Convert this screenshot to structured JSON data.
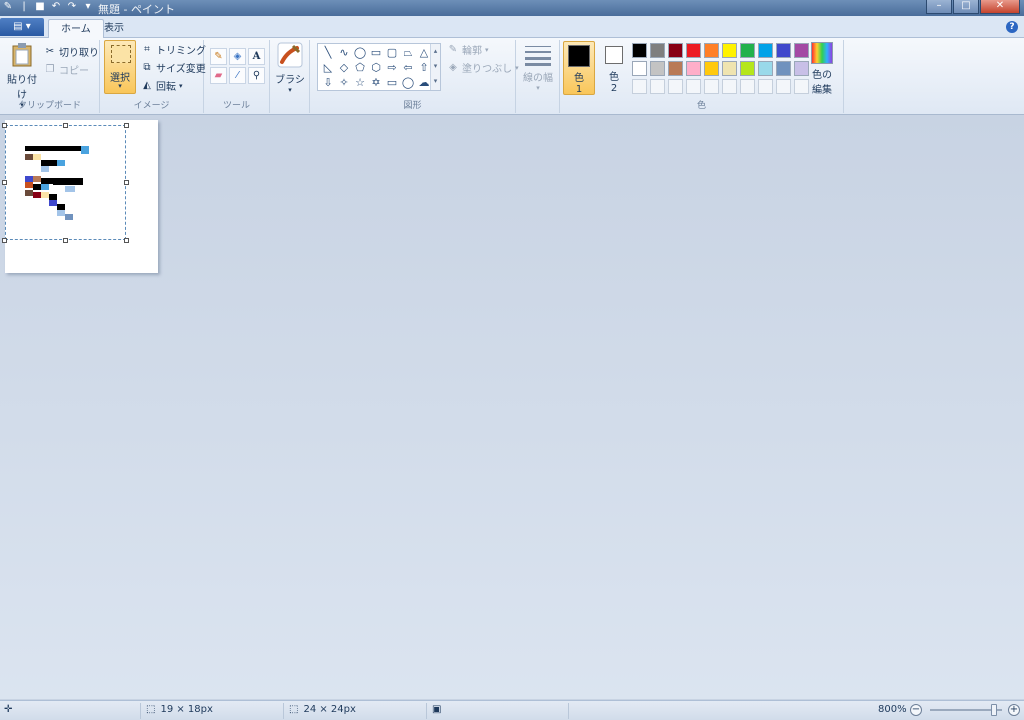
{
  "window": {
    "title": "無題 - ペイント",
    "buttons": {
      "minimize": "–",
      "maximize": "□",
      "close": "✕"
    }
  },
  "tabs": {
    "app_menu": "▤ ▾",
    "home": "ホーム",
    "view": "表示",
    "help": "?"
  },
  "clipboard": {
    "paste": "貼り付け",
    "cut": "切り取り",
    "copy": "コピー",
    "label": "クリップボード"
  },
  "image": {
    "select": "選択",
    "crop": "トリミング",
    "resize": "サイズ変更",
    "rotate": "回転",
    "label": "イメージ"
  },
  "tools": {
    "label": "ツール"
  },
  "brushes": {
    "label": "ブラシ"
  },
  "shapes": {
    "outline": "輪郭",
    "fill": "塗りつぶし",
    "label": "図形"
  },
  "size": {
    "label": "線の幅"
  },
  "colors": {
    "color1_label": "色\n1",
    "color1_a": "色",
    "color1_b": "1",
    "color2_a": "色",
    "color2_b": "2",
    "edit_a": "色の",
    "edit_b": "編集",
    "label": "色",
    "color1": "#000000",
    "color2": "#ffffff",
    "palette": [
      "#000000",
      "#7f7f7f",
      "#880015",
      "#ed1c24",
      "#ff7f27",
      "#fff200",
      "#22b14c",
      "#00a2e8",
      "#3f48cc",
      "#a349a4",
      "#ffffff",
      "#c3c3c3",
      "#b97a57",
      "#ffaec9",
      "#ffc90e",
      "#efe4b0",
      "#b5e61d",
      "#99d9ea",
      "#7092be",
      "#c8bfe7"
    ]
  },
  "status": {
    "selection_size": "19 × 18px",
    "image_size": "24 × 24px",
    "zoom": "800%"
  }
}
